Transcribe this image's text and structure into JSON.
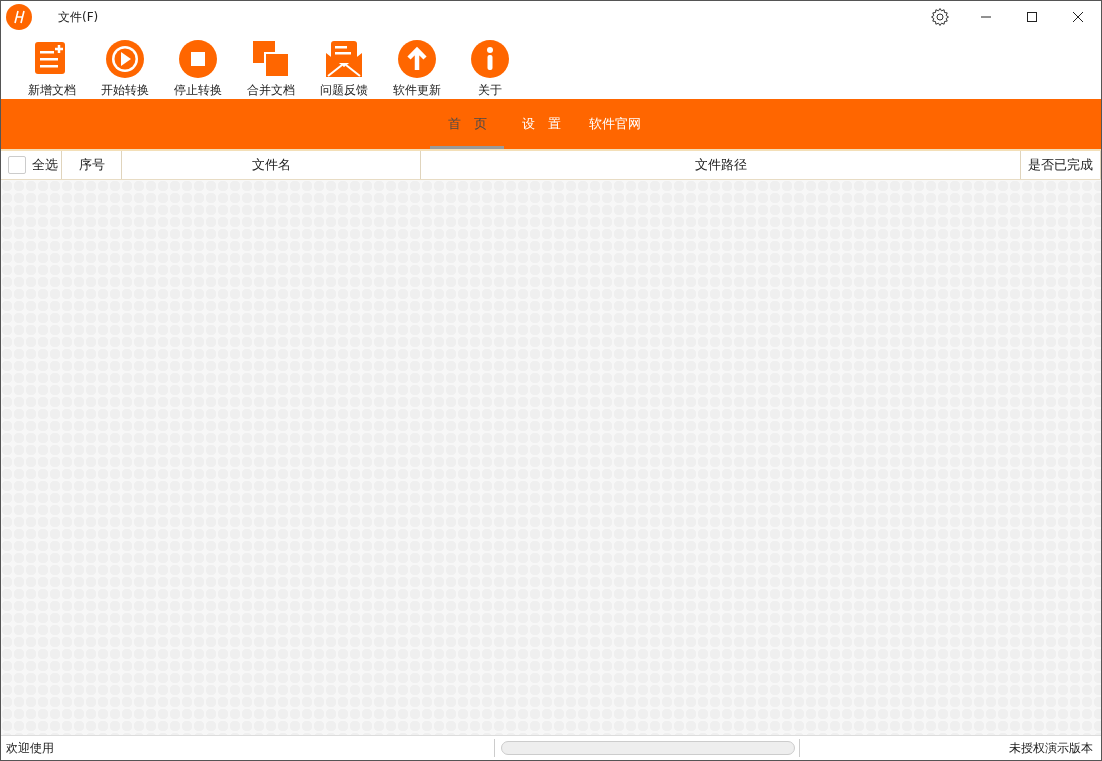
{
  "menu": [
    {
      "label": "文件(F)"
    }
  ],
  "toolbar": [
    {
      "kind": "new",
      "label": "新增文档"
    },
    {
      "kind": "start",
      "label": "开始转换"
    },
    {
      "kind": "stop",
      "label": "停止转换"
    },
    {
      "kind": "merge",
      "label": "合并文档"
    },
    {
      "kind": "feedback",
      "label": "问题反馈"
    },
    {
      "kind": "update",
      "label": "软件更新"
    },
    {
      "kind": "about",
      "label": "关于"
    }
  ],
  "tabs": [
    {
      "label": "首　页",
      "selected": true
    },
    {
      "label": "设　置",
      "selected": false
    },
    {
      "label": "软件官网",
      "selected": false
    }
  ],
  "table": {
    "select_all": {
      "label": "全选",
      "checked": false
    },
    "columns": [
      "序号",
      "文件名",
      "文件路径",
      "是否已完成"
    ]
  },
  "status_bar": {
    "message": "欢迎使用",
    "progress": {
      "level": 0
    },
    "license": "未授权演示版本"
  }
}
